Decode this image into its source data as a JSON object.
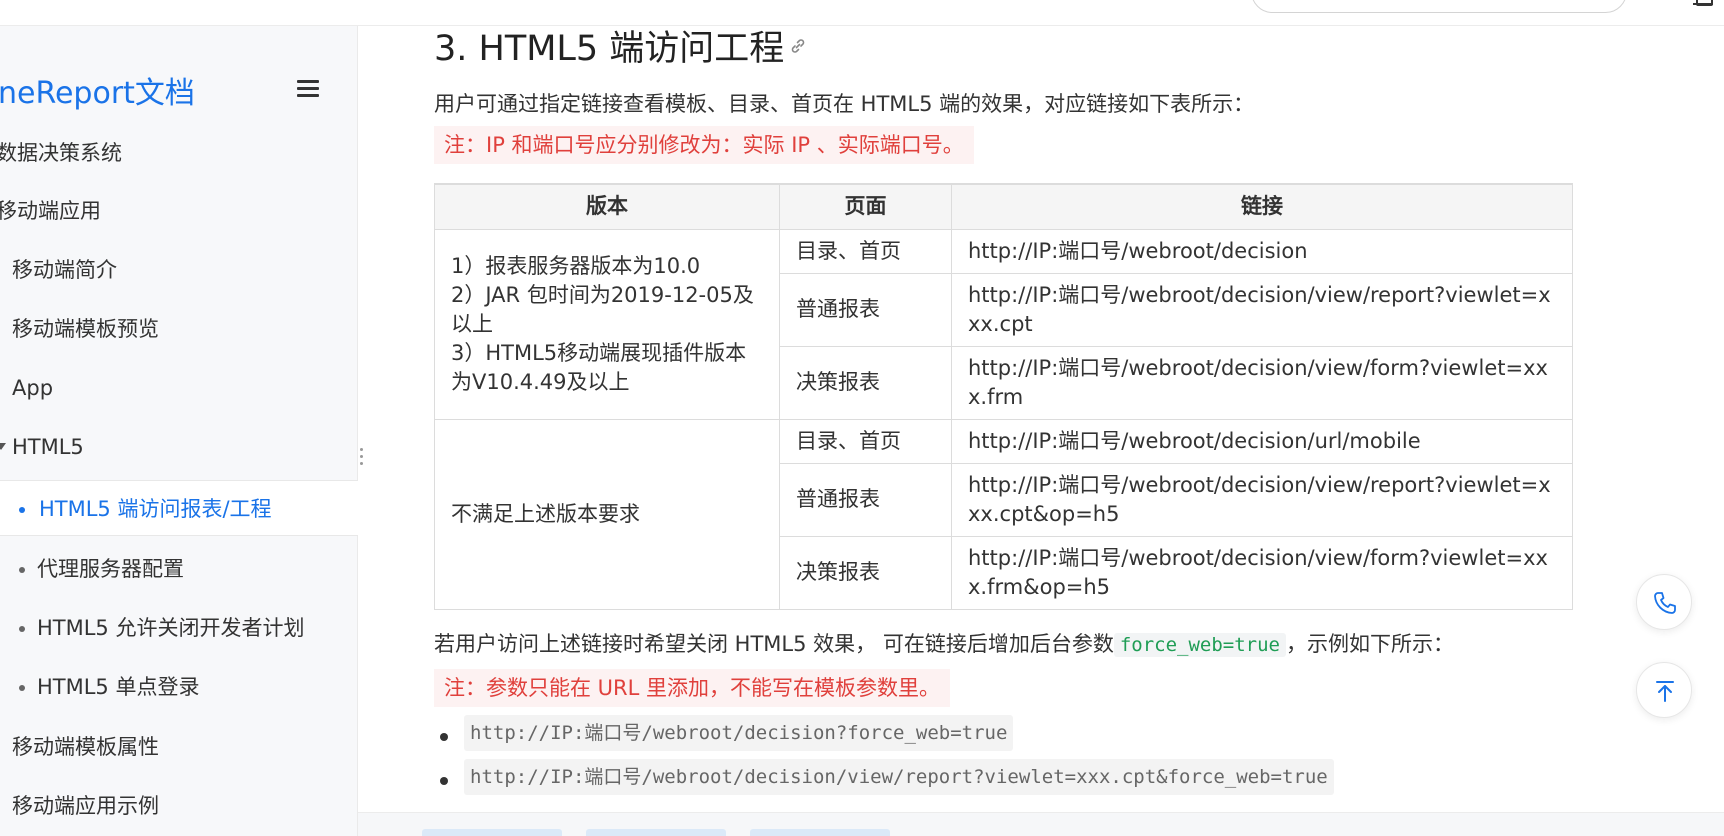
{
  "sidebar": {
    "logo": "neReport文档",
    "items": [
      {
        "label": "数据决策系统"
      },
      {
        "label": "移动端应用"
      },
      {
        "label": "移动端简介"
      },
      {
        "label": "移动端模板预览"
      },
      {
        "label": "App"
      },
      {
        "label": "HTML5"
      },
      {
        "label": "HTML5 端访问报表/工程"
      },
      {
        "label": "代理服务器配置"
      },
      {
        "label": "HTML5 允许关闭开发者计划"
      },
      {
        "label": "HTML5 单点登录"
      },
      {
        "label": "移动端模板属性"
      },
      {
        "label": "移动端应用示例"
      }
    ]
  },
  "content": {
    "heading": "3. HTML5 端访问工程",
    "intro": "用户可通过指定链接查看模板、目录、首页在 HTML5 端的效果，对应链接如下表所示：",
    "note1": "注：IP 和端口号应分别修改为：实际 IP 、实际端口号。",
    "table": {
      "headers": [
        "版本",
        "页面",
        "链接"
      ],
      "group1_version": [
        "1）报表服务器版本为10.0",
        "2）JAR 包时间为2019-12-05及以上",
        "3）HTML5移动端展现插件版本为V10.4.49及以上"
      ],
      "group2_version": "不满足上述版本要求",
      "rows": [
        {
          "page": "目录、首页",
          "link": "http://IP:端口号/webroot/decision"
        },
        {
          "page": "普通报表",
          "link": "http://IP:端口号/webroot/decision/view/report?viewlet=xxx.cpt"
        },
        {
          "page": "决策报表",
          "link": "http://IP:端口号/webroot/decision/view/form?viewlet=xxx.frm"
        },
        {
          "page": "目录、首页",
          "link": "http://IP:端口号/webroot/decision/url/mobile"
        },
        {
          "page": "普通报表",
          "link": "http://IP:端口号/webroot/decision/view/report?viewlet=xxx.cpt&op=h5"
        },
        {
          "page": "决策报表",
          "link": "http://IP:端口号/webroot/decision/view/form?viewlet=xxx.frm&op=h5"
        }
      ]
    },
    "para2_before": "若用户访问上述链接时希望关闭 HTML5 效果， 可在链接后增加后台参数",
    "para2_code": "force_web=true",
    "para2_after": "，示例如下所示：",
    "note2": "注：参数只能在 URL 里添加，不能写在模板参数里。",
    "examples": [
      "http://IP:端口号/webroot/decision?force_web=true",
      "http://IP:端口号/webroot/decision/view/report?viewlet=xxx.cpt&force_web=true"
    ]
  },
  "colors": {
    "accent": "#1a73e8",
    "note_text": "#e0403c",
    "note_bg": "#fdf2f2",
    "code_green": "#1f9d55"
  },
  "icons": {
    "menu": "hamburger-menu-icon",
    "heading_anchor": "link-icon",
    "float_top": "phone-icon",
    "float_bottom": "back-to-top-icon"
  }
}
